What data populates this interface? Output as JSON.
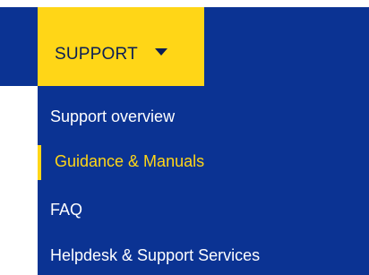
{
  "nav": {
    "tab_label": "SUPPORT",
    "tab_icon": "caret-down-icon"
  },
  "dropdown": {
    "items": [
      {
        "label": "Support overview",
        "active": false
      },
      {
        "label": "Guidance & Manuals",
        "active": true
      },
      {
        "label": "FAQ",
        "active": false
      },
      {
        "label": "Helpdesk & Support Services",
        "active": false
      }
    ]
  },
  "colors": {
    "nav_background": "#0b3393",
    "accent_yellow": "#ffd617",
    "menu_text": "#ffffff"
  }
}
